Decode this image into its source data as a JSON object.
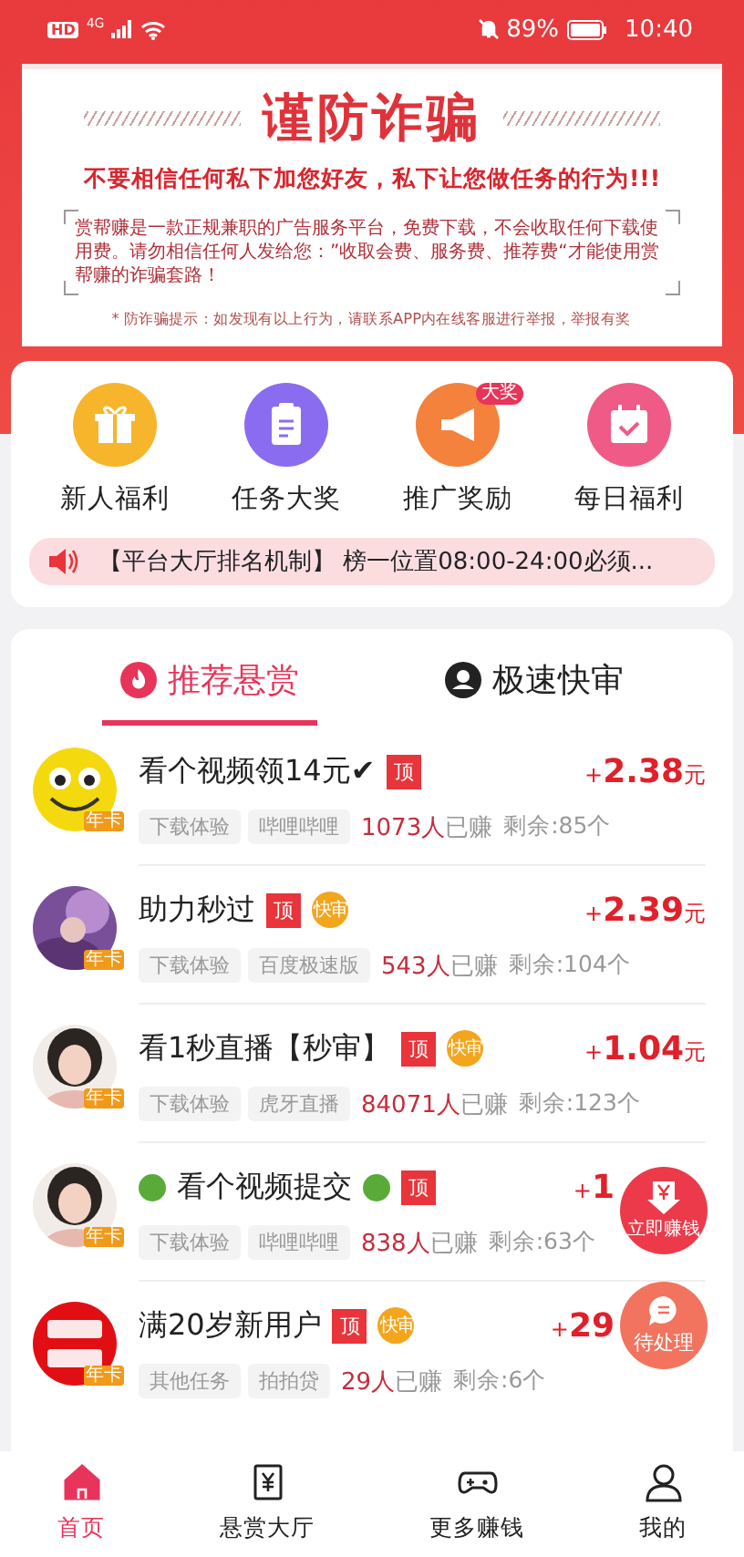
{
  "status_bar": {
    "hd": "HD",
    "network": "4G",
    "battery": "89%",
    "time": "10:40"
  },
  "warning": {
    "title": "谨防诈骗",
    "headline": "不要相信任何私下加您好友，私下让您做任务的行为!!!",
    "body": "赏帮赚是一款正规兼职的广告服务平台，免费下载，不会收取任何下载使用费。请勿相信任何人发给您：”收取会费、服务费、推荐费“才能使用赏帮赚的诈骗套路！",
    "note": "* 防诈骗提示：如发现有以上行为，请联系APP内在线客服进行举报，举报有奖"
  },
  "quick_menu": [
    {
      "kind": "gift",
      "label": "新人福利"
    },
    {
      "kind": "clipboard",
      "label": "任务大奖"
    },
    {
      "kind": "megaphone",
      "label": "推广奖励",
      "badge": "大奖"
    },
    {
      "kind": "calendar",
      "label": "每日福利"
    }
  ],
  "notice": "【平台大厅排名机制】 榜一位置08:00-24:00必须...",
  "tabs": [
    {
      "kind": "fire",
      "label": "推荐悬赏",
      "selected": true
    },
    {
      "kind": "person",
      "label": "极速快审",
      "selected": false
    }
  ],
  "tasks": [
    {
      "avatar_badge": "年卡",
      "title": "看个视频领14元✔",
      "green_dots": false,
      "top": "顶",
      "sign": "+",
      "price": "2.38",
      "unit": "元",
      "tags": [
        "下载体验",
        "哔哩哔哩"
      ],
      "earned": "1073人",
      "earned_label": "已赚",
      "remaining": "剩余:85个"
    },
    {
      "avatar_badge": "年卡",
      "title": "助力秒过",
      "green_dots": false,
      "top": "顶",
      "fast": "快审",
      "sign": "+",
      "price": "2.39",
      "unit": "元",
      "tags": [
        "下载体验",
        "百度极速版"
      ],
      "earned": "543人",
      "earned_label": "已赚",
      "remaining": "剩余:104个"
    },
    {
      "avatar_badge": "年卡",
      "title": "看1秒直播【秒审】",
      "green_dots": false,
      "top": "顶",
      "fast": "快审",
      "sign": "+",
      "price": "1.04",
      "unit": "元",
      "tags": [
        "下载体验",
        "虎牙直播"
      ],
      "earned": "84071人",
      "earned_label": "已赚",
      "remaining": "剩余:123个"
    },
    {
      "avatar_badge": "年卡",
      "title": "看个视频提交",
      "green_dots": true,
      "top": "顶",
      "sign": "+",
      "price": "1",
      "tags": [
        "下载体验",
        "哔哩哔哩"
      ],
      "earned": "838人",
      "earned_label": "已赚",
      "remaining": "剩余:63个"
    },
    {
      "avatar_badge": "年卡",
      "title": "满20岁新用户",
      "green_dots": false,
      "top": "顶",
      "fast": "快审",
      "sign": "+",
      "price": "29",
      "tags": [
        "其他任务",
        "拍拍贷"
      ],
      "earned": "29人",
      "earned_label": "已赚",
      "remaining": "剩余:6个"
    }
  ],
  "floating_buttons": [
    {
      "kind": "earn",
      "label": "立即赚钱"
    },
    {
      "kind": "pending",
      "label": "待处理"
    }
  ],
  "bottom_nav": [
    {
      "kind": "home",
      "label": "首页",
      "selected": true
    },
    {
      "kind": "reward",
      "label": "悬赏大厅",
      "selected": false
    },
    {
      "kind": "game",
      "label": "更多赚钱",
      "selected": false
    },
    {
      "kind": "user",
      "label": "我的",
      "selected": false
    }
  ]
}
